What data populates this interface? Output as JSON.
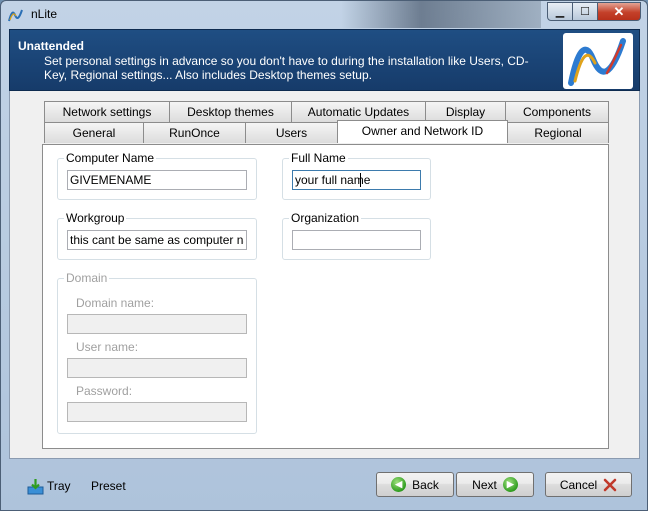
{
  "window": {
    "title": "nLite",
    "controls": {
      "minimize": "▁",
      "maximize": "☐",
      "close": "✕"
    }
  },
  "banner": {
    "title": "Unattended",
    "description": "Set personal settings in advance so you don't have to during the installation like Users, CD-Key, Regional settings... Also includes Desktop themes setup."
  },
  "tabs": {
    "row1": [
      "Network settings",
      "Desktop themes",
      "Automatic Updates",
      "Display",
      "Components"
    ],
    "row2": [
      "General",
      "RunOnce",
      "Users",
      "Owner and Network ID",
      "Regional"
    ],
    "active": "Owner and Network ID"
  },
  "form": {
    "computer_name": {
      "label": "Computer Name",
      "value": "GIVEMENAME"
    },
    "full_name": {
      "label": "Full Name",
      "value": "your full name"
    },
    "workgroup": {
      "label": "Workgroup",
      "value": "this cant be same as computer name"
    },
    "organization": {
      "label": "Organization",
      "value": ""
    },
    "domain": {
      "label": "Domain",
      "domain_name_label": "Domain name:",
      "user_name_label": "User name:",
      "password_label": "Password:"
    }
  },
  "bottom": {
    "tray": "Tray",
    "preset": "Preset",
    "back": "Back",
    "next": "Next",
    "cancel": "Cancel"
  },
  "colors": {
    "banner": "#1f4e83",
    "close_button": "#c4412a",
    "nav_arrow": "#2f9d1f",
    "cancel_x": "#c0392b"
  }
}
